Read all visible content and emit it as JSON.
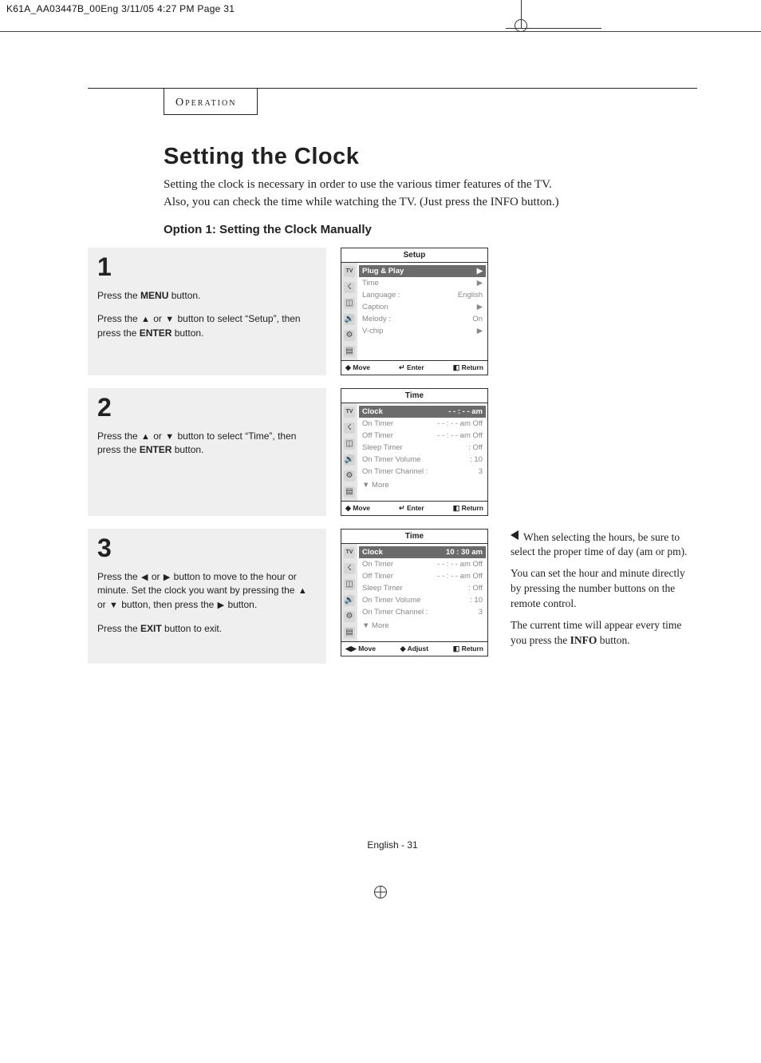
{
  "file_tag": "K61A_AA03447B_00Eng  3/11/05  4:27 PM  Page 31",
  "section_label": "Operation",
  "title": "Setting the Clock",
  "lead_line1": "Setting the clock is necessary in order to use the various timer features of the TV.",
  "lead_line2": "Also, you can check the time while watching the TV. (Just press the INFO button.)",
  "option_heading": "Option 1: Setting the Clock Manually",
  "steps": {
    "s1": {
      "num": "1",
      "p1_a": "Press the ",
      "p1_b": "MENU",
      "p1_c": " button.",
      "p2_a": "Press the ",
      "p2_b": " or ",
      "p2_c": " button to select “Setup”, then press the ",
      "p2_d": "ENTER",
      "p2_e": " button."
    },
    "s2": {
      "num": "2",
      "p_a": "Press the ",
      "p_b": " or ",
      "p_c": " button to select “Time”, then press the ",
      "p_d": "ENTER",
      "p_e": " button."
    },
    "s3": {
      "num": "3",
      "p1_a": "Press the ",
      "p1_b": " or ",
      "p1_c": " button to move to the hour or minute. Set the clock you want by pressing the ",
      "p1_d": " or ",
      "p1_e": " button, then press the ",
      "p1_f": " button.",
      "p2_a": "Press the ",
      "p2_b": "EXIT",
      "p2_c": " button to exit."
    }
  },
  "menus": {
    "setup": {
      "title": "Setup",
      "rows": [
        {
          "l": "Plug & Play",
          "r": "▶",
          "hi": true
        },
        {
          "l": "Time",
          "r": "▶"
        },
        {
          "l": "Language :",
          "r": "English"
        },
        {
          "l": "Caption",
          "r": "▶"
        },
        {
          "l": "Melody    :",
          "r": "On"
        },
        {
          "l": "V-chip",
          "r": "▶"
        }
      ],
      "foot": {
        "move": "Move",
        "enter": "Enter",
        "ret": "Return"
      }
    },
    "time1": {
      "title": "Time",
      "rows": [
        {
          "l": "Clock",
          "r": "- - : - -  am",
          "hi": true
        },
        {
          "l": "On Timer",
          "r": "- - : - -  am  Off"
        },
        {
          "l": "Off Timer",
          "r": "- - : - -  am  Off"
        },
        {
          "l": "Sleep Timer",
          "r": ": Off"
        },
        {
          "l": "On Timer Volume",
          "r": ": 10"
        },
        {
          "l": "On Timer Channel :",
          "r": "3"
        }
      ],
      "more": "▼ More",
      "foot": {
        "move": "Move",
        "enter": "Enter",
        "ret": "Return"
      }
    },
    "time2": {
      "title": "Time",
      "rows": [
        {
          "l": "Clock",
          "r": "10 : 30  am",
          "hi": true
        },
        {
          "l": "On Timer",
          "r": "- - : - -  am  Off"
        },
        {
          "l": "Off Timer",
          "r": "- - : - -  am  Off"
        },
        {
          "l": "Sleep Timer",
          "r": ": Off"
        },
        {
          "l": "On Timer Volume",
          "r": ": 10"
        },
        {
          "l": "On Timer Channel :",
          "r": "3"
        }
      ],
      "more": "▼ More",
      "foot": {
        "move": "Move",
        "enter": "Adjust",
        "ret": "Return"
      }
    }
  },
  "note": {
    "p1": "When selecting the hours, be sure to select the proper time of day (am or pm).",
    "p2": "You can set the hour and minute directly by pressing the number buttons on the remote control.",
    "p3_a": "The current time will appear every time you press the ",
    "p3_b": "INFO",
    "p3_c": " button."
  },
  "footer": "English - 31",
  "glyphs": {
    "up": "▲",
    "down": "▼",
    "left": "◀",
    "right": "▶",
    "updown": "◆",
    "lr": "◀▶",
    "enter": "↵",
    "ret": "❙❙❙"
  }
}
